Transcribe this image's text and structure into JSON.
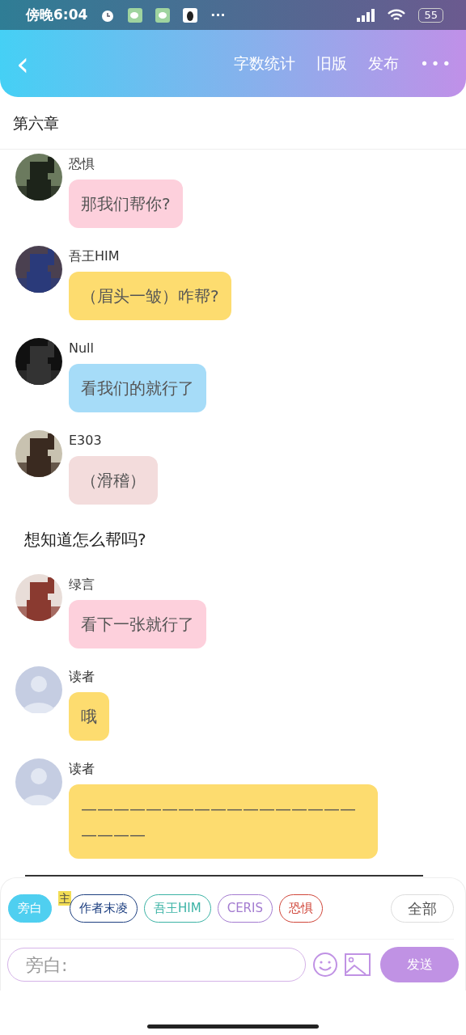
{
  "status_bar": {
    "time": "傍晚6:04",
    "more": "···",
    "battery": "55"
  },
  "nav": {
    "back": "‹",
    "actions": [
      "字数统计",
      "旧版",
      "发布"
    ],
    "more": "•••"
  },
  "chapter_title": "第六章",
  "messages": [
    {
      "speaker": "恐惧",
      "text": "那我们帮你?",
      "color": "#fdd0dc"
    },
    {
      "speaker": "吾王HIM",
      "text": "（眉头一皱）咋帮?",
      "color": "#fddc6f"
    },
    {
      "speaker": "Null",
      "text": "看我们的就行了",
      "color": "#a6dcf8"
    },
    {
      "speaker": "E303",
      "text": "（滑稽）",
      "color": "#f3dcdc"
    },
    {
      "kind": "narration",
      "text": "想知道怎么帮吗?"
    },
    {
      "speaker": "绿言",
      "text": "看下一张就行了",
      "color": "#fdd0dc"
    },
    {
      "kind": "default",
      "speaker": "读者",
      "text": "哦",
      "color": "#fddc6f"
    },
    {
      "kind": "default",
      "speaker": "读者",
      "text": "—————————————————————",
      "color": "#fddc6f"
    }
  ],
  "roles": [
    {
      "label": "旁白",
      "color": "#4fcff0",
      "selected": true
    },
    {
      "label": "作者末凌",
      "color": "#1d3f80",
      "selected": false,
      "badge": "主"
    },
    {
      "label": "吾王HIM",
      "color": "#3bb3a5",
      "selected": false
    },
    {
      "label": "CERIS",
      "color": "#a37bd0",
      "selected": false
    },
    {
      "label": "恐惧",
      "color": "#d0463a",
      "selected": false
    }
  ],
  "all_button": "全部",
  "composer": {
    "placeholder": "旁白:",
    "send": "发送"
  }
}
